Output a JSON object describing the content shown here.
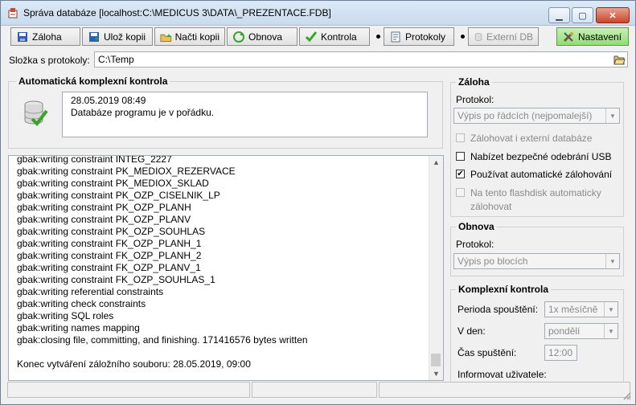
{
  "window": {
    "title": "Správa databáze [localhost:C:\\MEDICUS 3\\DATA\\_PREZENTACE.FDB]"
  },
  "toolbar": {
    "backup": "Záloha",
    "save_copy": "Ulož kopii",
    "load_copy": "Načti kopii",
    "restore": "Obnova",
    "check": "Kontrola",
    "protocols": "Protokoly",
    "external_db": "Externí DB",
    "settings": "Nastavení"
  },
  "folder": {
    "label": "Složka s protokoly:",
    "value": "C:\\Temp"
  },
  "auto_check": {
    "title": "Automatická komplexní kontrola",
    "lines": [
      "28.05.2019 08:49",
      "Databáze programu je v pořádku."
    ]
  },
  "log": {
    "lines": [
      "gbak:writing constraint INTEG_2227",
      "gbak:writing constraint PK_MEDIOX_REZERVACE",
      "gbak:writing constraint PK_MEDIOX_SKLAD",
      "gbak:writing constraint PK_OZP_CISELNIK_LP",
      "gbak:writing constraint PK_OZP_PLANH",
      "gbak:writing constraint PK_OZP_PLANV",
      "gbak:writing constraint PK_OZP_SOUHLAS",
      "gbak:writing constraint FK_OZP_PLANH_1",
      "gbak:writing constraint FK_OZP_PLANH_2",
      "gbak:writing constraint FK_OZP_PLANV_1",
      "gbak:writing constraint FK_OZP_SOUHLAS_1",
      "gbak:writing referential constraints",
      "gbak:writing check constraints",
      "gbak:writing SQL roles",
      "gbak:writing names mapping",
      "gbak:closing file, committing, and finishing. 171416576 bytes written",
      "",
      "Konec vytváření záložního souboru: 28.05.2019, 09:00"
    ]
  },
  "backup_group": {
    "title": "Záloha",
    "protocol_label": "Protokol:",
    "protocol_value": "Výpis po řádcích (nejpomalejší)",
    "opt_external": "Zálohovat i externí databáze",
    "opt_safe_usb": "Nabízet bezpečné odebrání USB",
    "opt_auto": "Používat automatické zálohování",
    "opt_flash_1": "Na tento flashdisk automaticky",
    "opt_flash_2": "zálohovat",
    "checked_auto": true,
    "checked_external": false,
    "checked_safe_usb": false,
    "checked_flash": false
  },
  "restore_group": {
    "title": "Obnova",
    "protocol_label": "Protokol:",
    "protocol_value": "Výpis po blocích"
  },
  "complex_group": {
    "title": "Komplexní kontrola",
    "period_label": "Perioda spouštění:",
    "period_value": "1x měsíčně",
    "day_label": "V den:",
    "day_value": "pondělí",
    "time_label": "Čas spuštění:",
    "time_value": "12:00",
    "notify_label": "Informovat uživatele:"
  },
  "colors": {
    "title_bg": "#c9dbee",
    "close_btn": "#c9452a",
    "settings_btn": "#92dc76",
    "check_green": "#3aa32a"
  }
}
